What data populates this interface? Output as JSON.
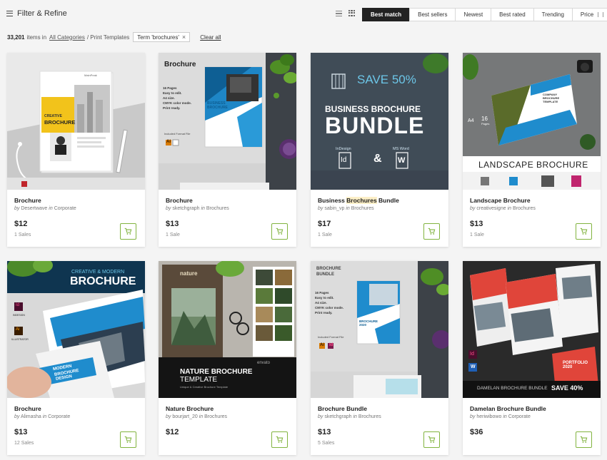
{
  "toolbar": {
    "filter_label": "Filter & Refine",
    "sort_options": [
      "Best match",
      "Best sellers",
      "Newest",
      "Best rated",
      "Trending",
      "Price"
    ],
    "active_sort": "Best match"
  },
  "results": {
    "count": "33,201",
    "count_suffix": "items in",
    "category_link": "All Categories",
    "category_path": "/ Print Templates",
    "term_chip": "Term 'brochures'",
    "chip_close": "×",
    "clear_all": "Clear all"
  },
  "products": [
    {
      "title": "Brochure",
      "by": "by",
      "author": "Desertwave",
      "in": "in",
      "category": "Corporate",
      "price": "$12",
      "sales": "1 Sales"
    },
    {
      "title": "Brochure",
      "by": "by",
      "author": "sketchgraph",
      "in": "in",
      "category": "Brochures",
      "price": "$13",
      "sales": "1 Sale"
    },
    {
      "title_pre": "Business ",
      "title_hl": "Brochures",
      "title_post": " Bundle",
      "by": "by",
      "author": "sabin_vp",
      "in": "in",
      "category": "Brochures",
      "price": "$17",
      "sales": "1 Sale"
    },
    {
      "title": "Landscape Brochure",
      "by": "by",
      "author": "creativesigne",
      "in": "in",
      "category": "Brochures",
      "price": "$13",
      "sales": "1 Sale"
    },
    {
      "title": "Brochure",
      "by": "by",
      "author": "Alimasha",
      "in": "in",
      "category": "Corporate",
      "price": "$13",
      "sales": "12 Sales"
    },
    {
      "title": "Nature Brochure",
      "by": "by",
      "author": "bourjart_20",
      "in": "in",
      "category": "Brochures",
      "price": "$12",
      "sales": ""
    },
    {
      "title": "Brochure Bundle",
      "by": "by",
      "author": "sketchgraph",
      "in": "in",
      "category": "Brochures",
      "price": "$13",
      "sales": "5 Sales"
    },
    {
      "title": "Damelan Brochure Bundle",
      "by": "by",
      "author": "heriwibowo",
      "in": "in",
      "category": "Corporate",
      "price": "$36",
      "sales": ""
    }
  ],
  "thumb_text": {
    "t1": {
      "brand": "MainPeak",
      "headline1": "CREATIVE",
      "headline2": "BROCHURE"
    },
    "t2": {
      "label": "Brochure",
      "specs": [
        "16 Pages",
        "Easy to edit.",
        "A4 size.",
        "CMYK color mode.",
        "Print ready."
      ],
      "cover": "BUSINESS BROCHURE",
      "formats": "Included Format File",
      "ai": "Ai"
    },
    "t3": {
      "save": "SAVE 50%",
      "line1": "BUSINESS BROCHURE",
      "line2": "BUNDLE",
      "indesign": "InDesign",
      "msword": "MS Word",
      "id": "Id",
      "amp": "&",
      "w": "W"
    },
    "t4": {
      "cover": "COMPANY BROCHURE TEMPLATE",
      "a4": "A4",
      "pages": "16",
      "pages_label": "Pages",
      "banner": "LANDSCAPE BROCHURE"
    },
    "t5": {
      "line1": "CREATIVE & MODERN",
      "line2": "BROCHURE",
      "id": "Id",
      "indesign": "INDESIGN",
      "ai": "Ai",
      "illustrator": "ILLUSTRATOR",
      "cover1": "MODERN",
      "cover2": "BROCHURE",
      "cover3": "DESIGN"
    },
    "t6": {
      "brand": "nature",
      "line1": "NATURE BROCHURE",
      "line2": "TEMPLATE",
      "envato": "envato",
      "small": "Unique & Creative Brochure Template"
    },
    "t7": {
      "label1": "BROCHURE",
      "label2": "BUNDLE",
      "specs": [
        "16 Pages",
        "Easy to edit.",
        "A4 size.",
        "CMYK color mode.",
        "Print ready."
      ],
      "cover": "BROCHURE 2020",
      "formats": "Included Format File",
      "ai": "Ai",
      "id": "Id"
    },
    "t8": {
      "banner_left": "DAMELAN BROCHURE BUNDLE",
      "banner_right": "SAVE 40%",
      "id": "Id",
      "w": "W",
      "portfolio": "PORTFOLIO 2020"
    }
  },
  "colors": {
    "accent_green": "#82b440",
    "brochure_yellow": "#f2c31b",
    "blue": "#1f8ccd",
    "red": "#e0453a"
  }
}
